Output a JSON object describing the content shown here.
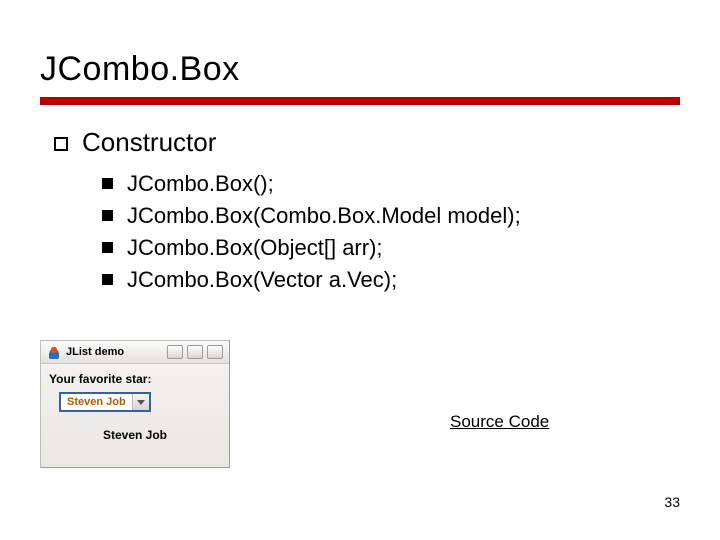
{
  "title": "JCombo.Box",
  "section": {
    "heading": "Constructor",
    "items": [
      "JCombo.Box();",
      "JCombo.Box(Combo.Box.Model model);",
      "JCombo.Box(Object[] arr);",
      "JCombo.Box(Vector a.Vec);"
    ]
  },
  "demo": {
    "windowTitle": "JList demo",
    "label": "Your favorite star:",
    "comboValue": "Steven Job",
    "selected": "Steven Job"
  },
  "link": "Source Code",
  "page": "33"
}
